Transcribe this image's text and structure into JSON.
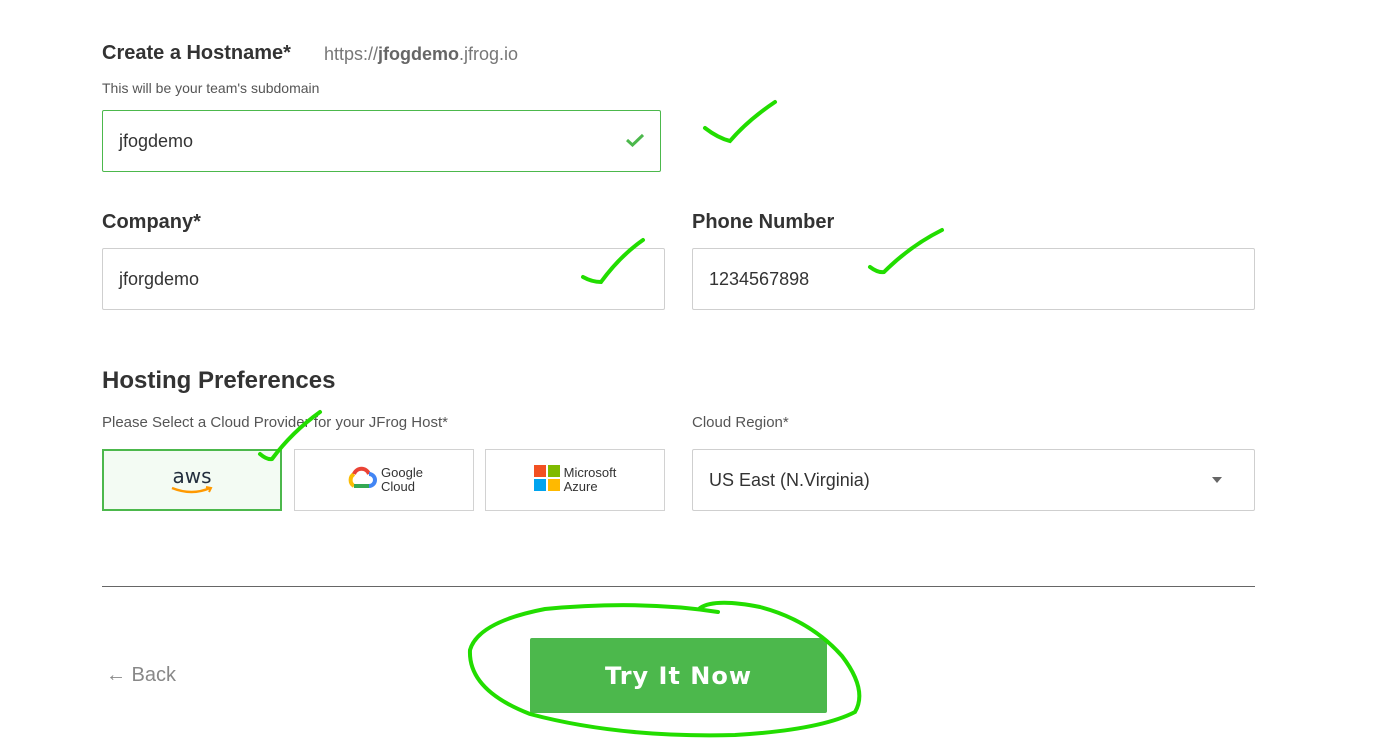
{
  "hostname": {
    "label": "Create a Hostname*",
    "preview_prefix": "https://",
    "preview_host": "jfogdemo",
    "preview_suffix": ".jfrog.io",
    "hint": "This will be your team's subdomain",
    "value": "jfogdemo",
    "status_icon": "check-icon"
  },
  "company": {
    "label": "Company*",
    "value": "jforgdemo"
  },
  "phone": {
    "label": "Phone Number",
    "value": "1234567898"
  },
  "hosting": {
    "title": "Hosting Preferences",
    "provider_label": "Please Select a Cloud Provider for your JFrog Host*",
    "providers": [
      {
        "name": "aws",
        "selected": true
      },
      {
        "name": "Google Cloud",
        "line1": "Google",
        "line2": "Cloud",
        "selected": false
      },
      {
        "name": "Microsoft Azure",
        "line1": "Microsoft",
        "line2": "Azure",
        "selected": false
      }
    ],
    "region_label": "Cloud Region*",
    "region_value": "US East (N.Virginia)"
  },
  "footer": {
    "back_label": "← Back",
    "submit_label": "Try It Now"
  },
  "colors": {
    "accent": "#4cb84c",
    "annotation": "#22dd00"
  }
}
